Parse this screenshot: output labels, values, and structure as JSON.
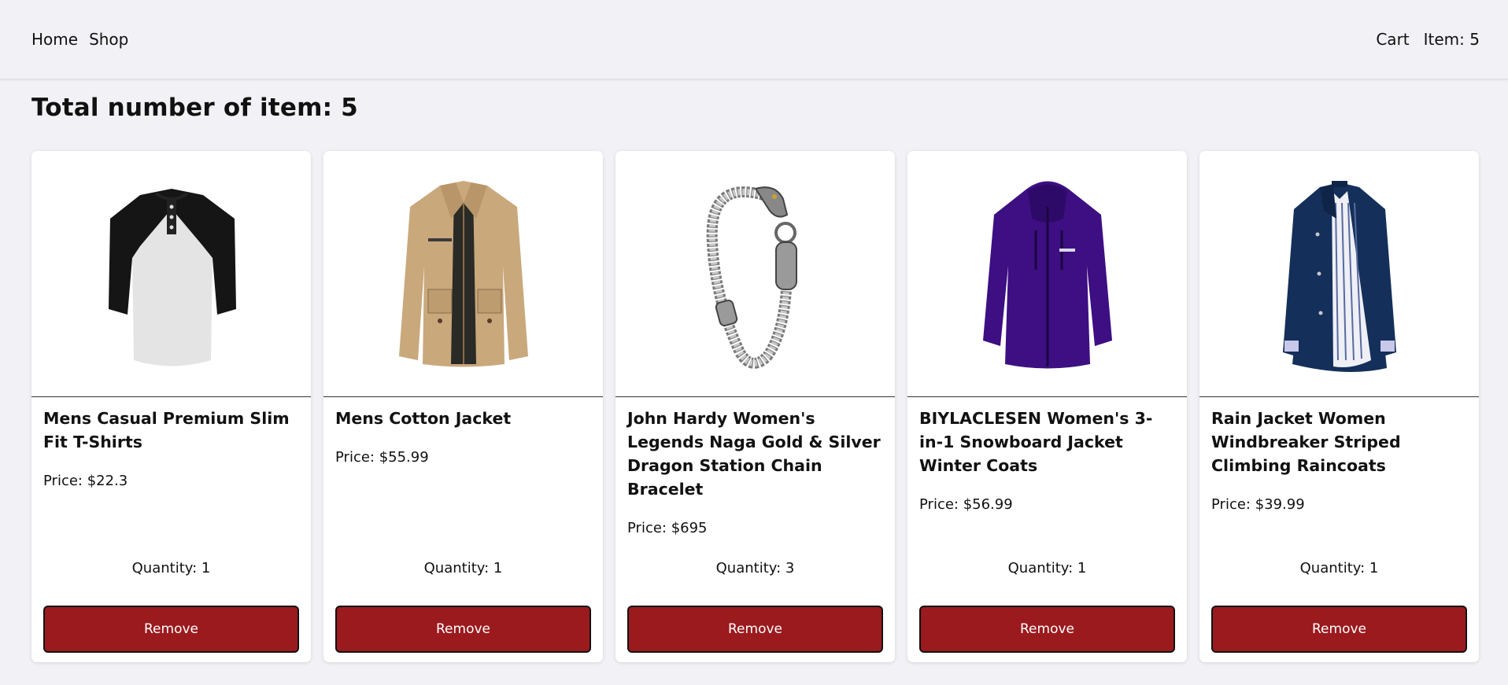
{
  "navbar": {
    "home_label": "Home",
    "shop_label": "Shop",
    "cart_label": "Cart",
    "item_count_label": "Item: 5"
  },
  "heading": "Total number of item: 5",
  "products": [
    {
      "title": "Mens Casual Premium Slim Fit T-Shirts",
      "price": "Price: $22.3",
      "quantity": "Quantity: 1",
      "remove_label": "Remove",
      "image_name": "raglan-tshirt-image"
    },
    {
      "title": "Mens Cotton Jacket",
      "price": "Price: $55.99",
      "quantity": "Quantity: 1",
      "remove_label": "Remove",
      "image_name": "cotton-jacket-image"
    },
    {
      "title": "John Hardy Women's Legends Naga Gold & Silver Dragon Station Chain Bracelet",
      "price": "Price: $695",
      "quantity": "Quantity: 3",
      "remove_label": "Remove",
      "image_name": "dragon-bracelet-image"
    },
    {
      "title": "BIYLACLESEN Women's 3-in-1 Snowboard Jacket Winter Coats",
      "price": "Price: $56.99",
      "quantity": "Quantity: 1",
      "remove_label": "Remove",
      "image_name": "purple-snowboard-jacket-image"
    },
    {
      "title": "Rain Jacket Women Windbreaker Striped Climbing Raincoats",
      "price": "Price: $39.99",
      "quantity": "Quantity: 1",
      "remove_label": "Remove",
      "image_name": "navy-raincoat-image"
    }
  ],
  "colors": {
    "remove_button": "#9b1a1e",
    "page_background": "#f2f2f6",
    "card_background": "#ffffff"
  }
}
